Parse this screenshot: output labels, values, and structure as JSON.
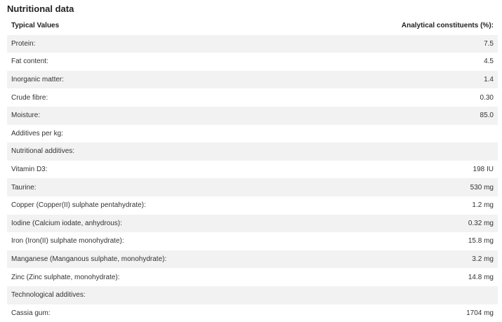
{
  "title": "Nutritional data",
  "table": {
    "headers": {
      "left": "Typical Values",
      "right": "Analytical constituents (%):"
    },
    "rows": [
      {
        "label": "Protein:",
        "value": "7.5"
      },
      {
        "label": "Fat content:",
        "value": "4.5"
      },
      {
        "label": "Inorganic matter:",
        "value": "1.4"
      },
      {
        "label": "Crude fibre:",
        "value": "0.30"
      },
      {
        "label": "Moisture:",
        "value": "85.0"
      },
      {
        "label": "Additives per kg:",
        "value": ""
      },
      {
        "label": "Nutritional additives:",
        "value": ""
      },
      {
        "label": "Vitamin D3:",
        "value": "198 IU"
      },
      {
        "label": "Taurine:",
        "value": "530 mg"
      },
      {
        "label": "Copper (Copper(II) sulphate pentahydrate):",
        "value": "1.2 mg"
      },
      {
        "label": "Iodine (Calcium iodate, anhydrous):",
        "value": "0.32 mg"
      },
      {
        "label": "Iron (Iron(II) sulphate monohydrate):",
        "value": "15.8 mg"
      },
      {
        "label": "Manganese (Manganous sulphate, monohydrate):",
        "value": "3.2 mg"
      },
      {
        "label": "Zinc (Zinc sulphate, monohydrate):",
        "value": "14.8 mg"
      },
      {
        "label": "Technological additives:",
        "value": ""
      },
      {
        "label": "Cassia gum:",
        "value": "1704 mg"
      }
    ]
  },
  "colors": {
    "stripe": "#f2f2f2",
    "text": "#333333"
  }
}
